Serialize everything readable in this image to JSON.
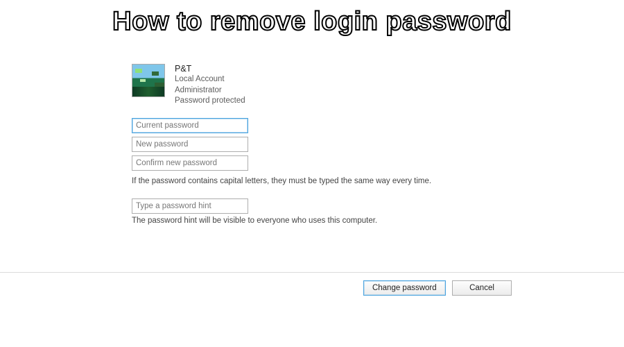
{
  "headline": "How to remove login password",
  "account": {
    "name": "P&T",
    "type": "Local Account",
    "role": "Administrator",
    "status": "Password protected"
  },
  "fields": {
    "current_password": {
      "placeholder": "Current password",
      "value": ""
    },
    "new_password": {
      "placeholder": "New password",
      "value": ""
    },
    "confirm_password": {
      "placeholder": "Confirm new password",
      "value": ""
    },
    "caps_help": "If the password contains capital letters, they must be typed the same way every time.",
    "hint": {
      "placeholder": "Type a password hint",
      "value": ""
    },
    "hint_help": "The password hint will be visible to everyone who uses this computer."
  },
  "buttons": {
    "change": "Change password",
    "cancel": "Cancel"
  }
}
